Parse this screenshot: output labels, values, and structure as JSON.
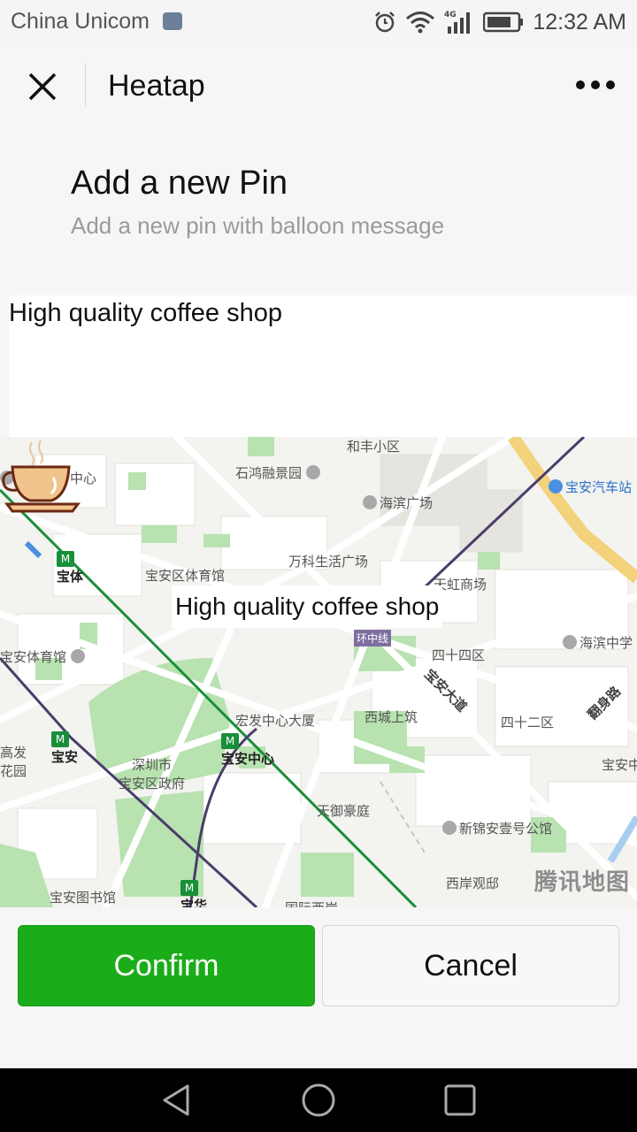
{
  "status_bar": {
    "carrier": "China Unicom",
    "network": "4G",
    "time": "12:32 AM"
  },
  "header": {
    "title": "Heatap",
    "close_icon": "close-icon",
    "more_icon": "more-icon"
  },
  "page": {
    "title": "Add a new Pin",
    "subtitle": "Add a new pin with balloon message"
  },
  "message_input": {
    "value": "High quality coffee shop"
  },
  "map": {
    "balloon_text": "High quality coffee shop",
    "pin_icon": "coffee-cup-icon",
    "watermark": "腾讯地图",
    "labels": {
      "hefeng": "和丰小区",
      "shihong": "石鸿融景园",
      "meiju": "美居商务中心",
      "haibin_plaza": "海滨广场",
      "baoan_bus": "宝安汽车站",
      "wanke": "万科生活广场",
      "tianhong": "天虹商场",
      "baoti": "宝体",
      "stadium": "宝安区体育馆",
      "huanzhong": "环中线",
      "haibin_school": "海滨中学",
      "baoan_gym": "宝安体育馆",
      "sishi": "四十四区",
      "baoan_road": "宝安大道",
      "fanshen": "翻身路",
      "hongfa": "宏发中心大厦",
      "xicheng": "西城上筑",
      "sishier": "四十二区",
      "gaofa": "高发",
      "huayuan": "花园",
      "baoan": "宝安",
      "shenzhen_gov": "深圳市",
      "baoan_gov": "宝安区政府",
      "baoan_center": "宝安中心",
      "baoan_zhong": "宝安中",
      "tianyu": "天御豪庭",
      "xinjin": "新锦安壹号公馆",
      "xian": "西岸观邸",
      "library": "宝安图书馆",
      "baohua": "宝华",
      "guoji": "国际西岸",
      "metro_glyph": "M"
    }
  },
  "buttons": {
    "confirm": "Confirm",
    "cancel": "Cancel"
  },
  "nav": {
    "back_icon": "back-triangle-icon",
    "home_icon": "home-circle-icon",
    "recents_icon": "recents-square-icon"
  },
  "colors": {
    "confirm_green": "#1aad19",
    "metro_green": "#1a8f3a",
    "park_green": "#b8e2b0",
    "road_yellow": "#f2d27a"
  }
}
